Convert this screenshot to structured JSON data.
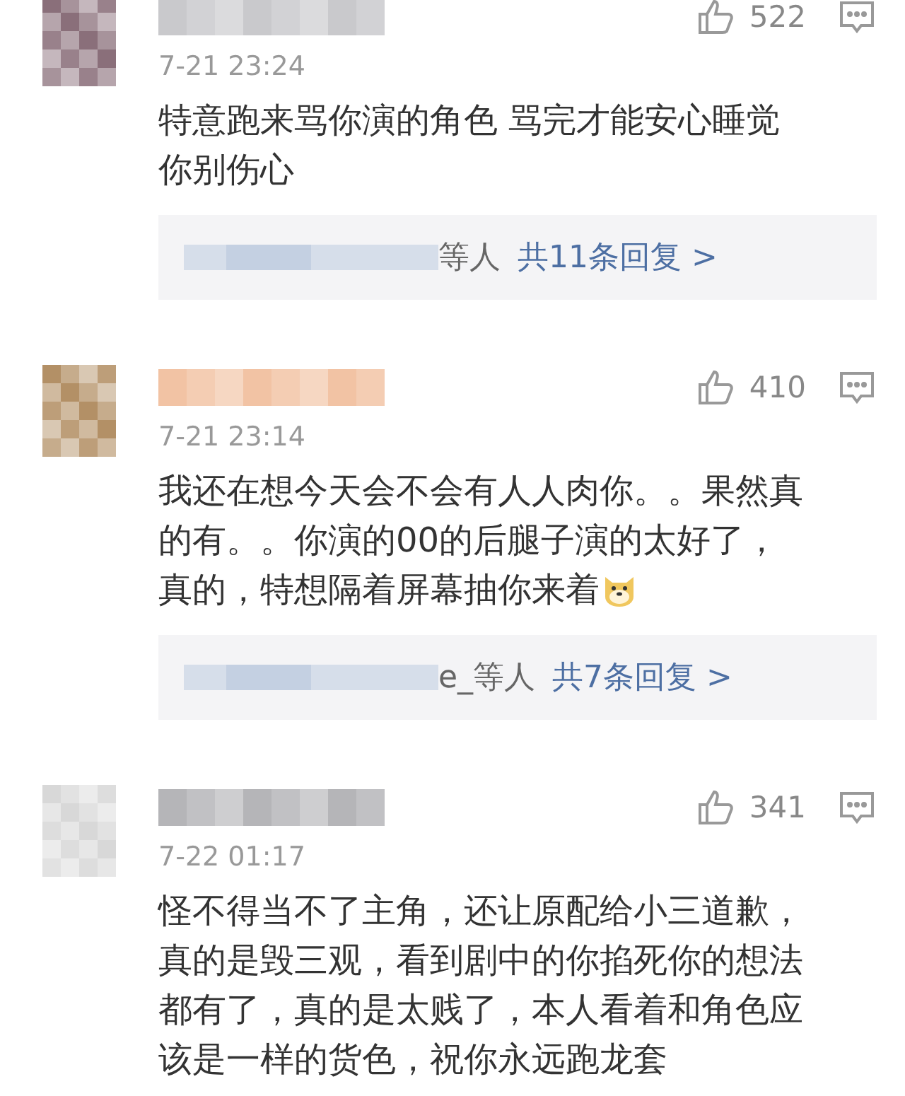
{
  "comments": [
    {
      "time": "7-21 23:24",
      "likes": "522",
      "body_lines": [
        "特意跑来骂你演的角色 骂完才能安心睡觉",
        "你别伤心"
      ],
      "has_emoji": false,
      "reply": {
        "tail": "等人",
        "count": "共11条回复 >"
      }
    },
    {
      "time": "7-21 23:14",
      "likes": "410",
      "body_lines": [
        "我还在想今天会不会有人人肉你。。果然真",
        "的有。。你演的00的后腿子演的太好了，",
        "真的，特想隔着屏幕抽你来着"
      ],
      "has_emoji": true,
      "reply": {
        "tail": "e_等人",
        "count": "共7条回复 >"
      }
    },
    {
      "time": "7-22 01:17",
      "likes": "341",
      "body_lines": [
        "怪不得当不了主角，还让原配给小三道歉，",
        "真的是毁三观，看到剧中的你掐死你的想法",
        "都有了，真的是太贱了，本人看着和角色应",
        "该是一样的货色，祝你永远跑龙套"
      ],
      "has_emoji": false
    }
  ]
}
